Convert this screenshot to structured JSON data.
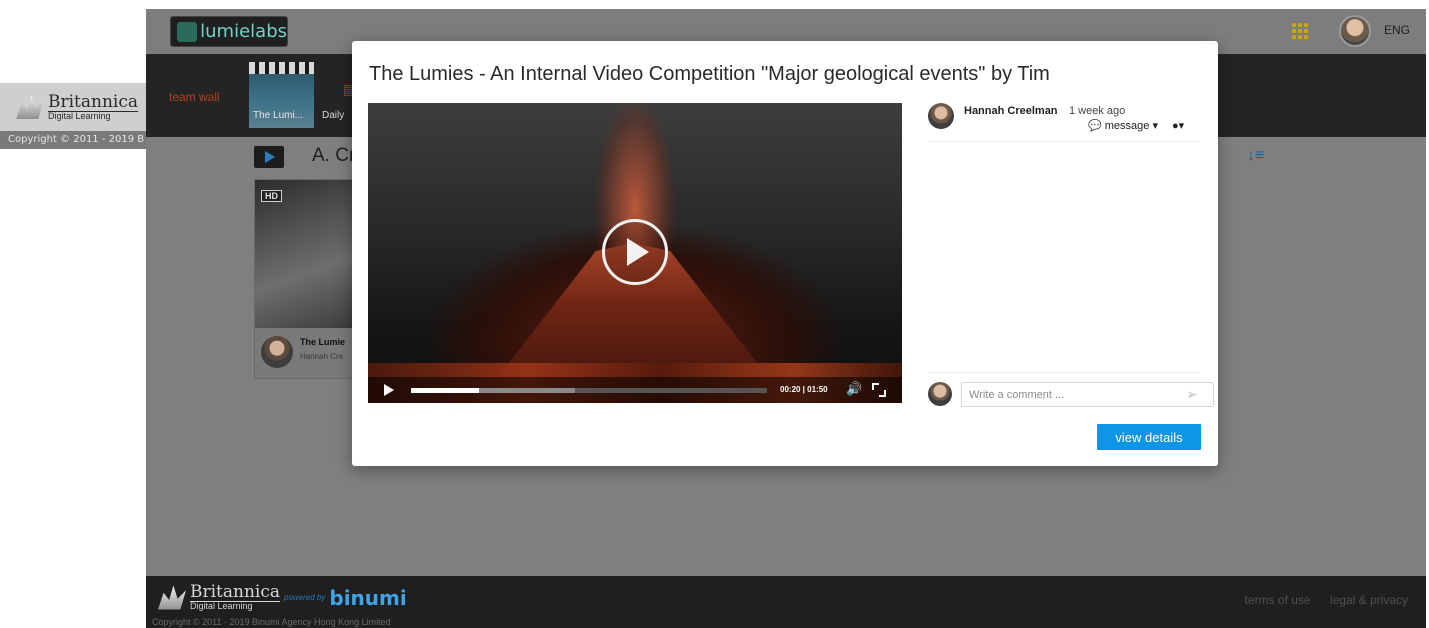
{
  "left_strip": {
    "brand_top": "Britannica",
    "brand_bottom": "Digital Learning",
    "copyright": "Copyright © 2011 - 2019 B"
  },
  "header": {
    "logo_text": "lumielabs",
    "language": "ENG"
  },
  "nav": {
    "team_wall": "team wall",
    "thumb_label": "The Lumi...",
    "daily": "Daily"
  },
  "section": {
    "title": "A. Cr"
  },
  "card": {
    "badge": "HD",
    "title": "The Lumie",
    "author": "Hannah Cre"
  },
  "modal": {
    "title": "The Lumies - An Internal Video Competition \"Major geological events\" by Tim",
    "player": {
      "time": "00:20 | 01:50",
      "progress_fraction": 0.19,
      "buffered_fraction": 0.46
    },
    "comment": {
      "author": "Hannah Creelman",
      "time_ago": "1 week ago",
      "message_label": "message",
      "placeholder": "Write a comment ..."
    },
    "view_details": "view details"
  },
  "footer": {
    "brand_top": "Britannica",
    "brand_bottom": "Digital Learning",
    "powered_by": "powered by",
    "binumi": "binumi",
    "copyright": "Copyright © 2011 - 2019 Binumi Agency Hong Kong Limited",
    "terms": "terms of use",
    "privacy": "legal & privacy"
  },
  "colors": {
    "accent_blue": "#0d96e6",
    "team_wall_orange": "#b3421b",
    "overlay_gray": "#7f7f7f"
  }
}
